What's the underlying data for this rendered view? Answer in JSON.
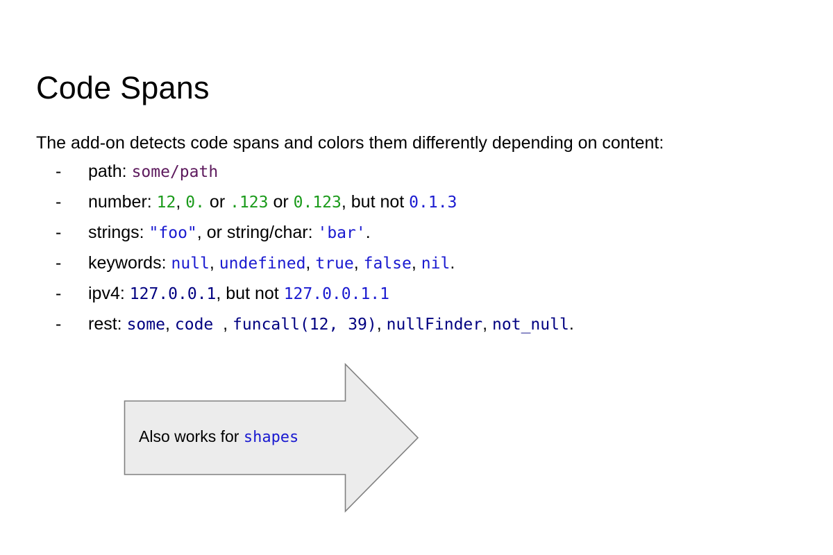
{
  "slide": {
    "title": "Code Spans",
    "intro": "The add-on detects code spans and colors them differently depending on content:",
    "bullet_marker": "-",
    "bullets": [
      {
        "label": "path:",
        "segments": [
          {
            "text": " ",
            "style": "plain"
          },
          {
            "text": "some/path",
            "style": "path"
          }
        ]
      },
      {
        "label": "number:",
        "segments": [
          {
            "text": " ",
            "style": "plain"
          },
          {
            "text": "12",
            "style": "number"
          },
          {
            "text": ", ",
            "style": "plain"
          },
          {
            "text": "0.",
            "style": "number"
          },
          {
            "text": " or ",
            "style": "plain"
          },
          {
            "text": ".123",
            "style": "number"
          },
          {
            "text": " or ",
            "style": "plain"
          },
          {
            "text": "0.123",
            "style": "number"
          },
          {
            "text": ", but not ",
            "style": "plain"
          },
          {
            "text": "0.1.3",
            "style": "invalid-number"
          }
        ]
      },
      {
        "label": "strings:",
        "segments": [
          {
            "text": " ",
            "style": "plain"
          },
          {
            "text": "\"foo\"",
            "style": "string"
          },
          {
            "text": ", or string/char: ",
            "style": "plain"
          },
          {
            "text": "'bar'",
            "style": "string"
          },
          {
            "text": ".",
            "style": "plain"
          }
        ]
      },
      {
        "label": "keywords:",
        "segments": [
          {
            "text": " ",
            "style": "plain"
          },
          {
            "text": "null",
            "style": "keyword"
          },
          {
            "text": ", ",
            "style": "plain"
          },
          {
            "text": "undefined",
            "style": "keyword"
          },
          {
            "text": ", ",
            "style": "plain"
          },
          {
            "text": "true",
            "style": "keyword"
          },
          {
            "text": ", ",
            "style": "plain"
          },
          {
            "text": "false",
            "style": "keyword"
          },
          {
            "text": ", ",
            "style": "plain"
          },
          {
            "text": "nil",
            "style": "keyword"
          },
          {
            "text": ".",
            "style": "plain"
          }
        ]
      },
      {
        "label": "ipv4:",
        "segments": [
          {
            "text": " ",
            "style": "plain"
          },
          {
            "text": "127.0.0.1",
            "style": "ipv4"
          },
          {
            "text": ", but not ",
            "style": "plain"
          },
          {
            "text": "127.0.0.1.1",
            "style": "invalid-ipv4"
          }
        ]
      },
      {
        "label": "rest:",
        "segments": [
          {
            "text": " ",
            "style": "plain"
          },
          {
            "text": "some",
            "style": "identifier"
          },
          {
            "text": ", ",
            "style": "plain"
          },
          {
            "text": "code ",
            "style": "identifier"
          },
          {
            "text": ", ",
            "style": "plain"
          },
          {
            "text": "funcall(12, 39)",
            "style": "identifier"
          },
          {
            "text": ", ",
            "style": "plain"
          },
          {
            "text": "nullFinder",
            "style": "identifier"
          },
          {
            "text": ", ",
            "style": "plain"
          },
          {
            "text": "not_null",
            "style": "identifier"
          },
          {
            "text": ".",
            "style": "plain"
          }
        ]
      }
    ],
    "shape": {
      "kind": "right-block-arrow",
      "label_plain": "Also works for ",
      "label_code": "shapes",
      "fill": "#ECECEC",
      "stroke": "#808080"
    }
  },
  "colors": {
    "path": "#5d1a5d",
    "number": "#1a9a1a",
    "string": "#1a1ad0",
    "keyword": "#1a1ad0",
    "ipv4": "#000080",
    "invalid_ipv4": "#1a1ad0",
    "invalid_number": "#1a1ad0",
    "identifier": "#000080",
    "shape_code": "#1a1ad0",
    "text": "#000000",
    "background": "#ffffff"
  }
}
